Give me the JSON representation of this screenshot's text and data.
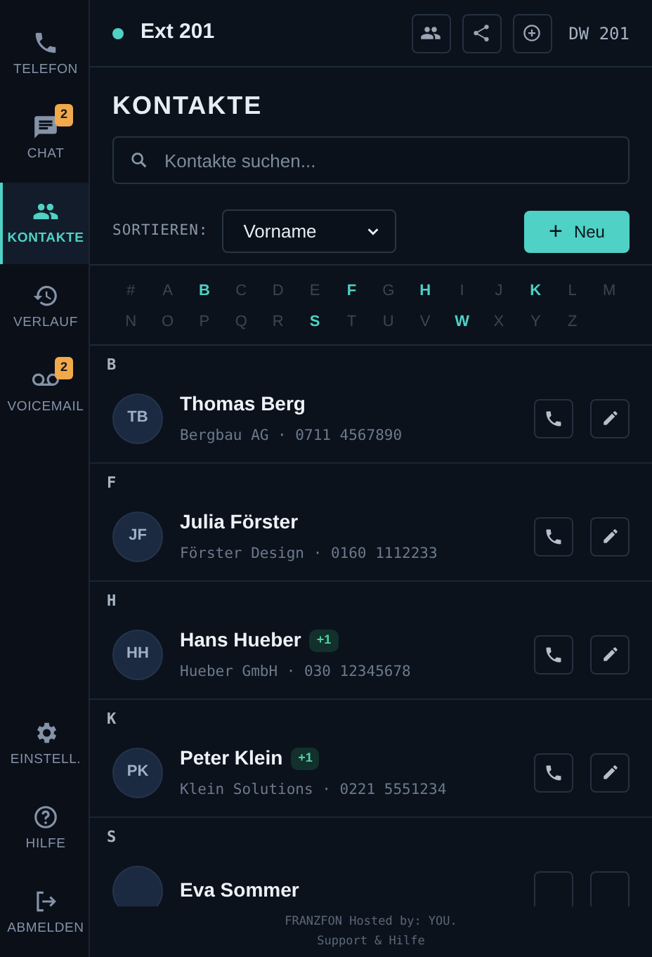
{
  "sidebar": {
    "items": [
      {
        "label": "TELEFON",
        "selected": false
      },
      {
        "label": "CHAT",
        "selected": false,
        "badge": "2"
      },
      {
        "label": "KONTAKTE",
        "selected": true
      },
      {
        "label": "VERLAUF",
        "selected": false
      },
      {
        "label": "VOICEMAIL",
        "selected": false,
        "badge": "2"
      }
    ],
    "bottom_items": [
      {
        "label": "EINSTELL."
      },
      {
        "label": "HILFE"
      },
      {
        "label": "ABMELDEN"
      }
    ]
  },
  "header": {
    "online": true,
    "extension": "Ext 201",
    "device": "DW 201"
  },
  "title": "KONTAKTE",
  "search": {
    "placeholder": "Kontakte suchen..."
  },
  "sort": {
    "label": "SORTIEREN:",
    "value": "Vorname"
  },
  "new_button": {
    "icon": "+",
    "label": "Neu"
  },
  "alphabet": [
    {
      "letter": "#",
      "active": false
    },
    {
      "letter": "A",
      "active": false
    },
    {
      "letter": "B",
      "active": true
    },
    {
      "letter": "C",
      "active": false
    },
    {
      "letter": "D",
      "active": false
    },
    {
      "letter": "E",
      "active": false
    },
    {
      "letter": "F",
      "active": true
    },
    {
      "letter": "G",
      "active": false
    },
    {
      "letter": "H",
      "active": true
    },
    {
      "letter": "I",
      "active": false
    },
    {
      "letter": "J",
      "active": false
    },
    {
      "letter": "K",
      "active": true
    },
    {
      "letter": "L",
      "active": false
    },
    {
      "letter": "M",
      "active": false
    },
    {
      "letter": "N",
      "active": false
    },
    {
      "letter": "O",
      "active": false
    },
    {
      "letter": "P",
      "active": false
    },
    {
      "letter": "Q",
      "active": false
    },
    {
      "letter": "R",
      "active": false
    },
    {
      "letter": "S",
      "active": true
    },
    {
      "letter": "T",
      "active": false
    },
    {
      "letter": "U",
      "active": false
    },
    {
      "letter": "V",
      "active": false
    },
    {
      "letter": "W",
      "active": true
    },
    {
      "letter": "X",
      "active": false
    },
    {
      "letter": "Y",
      "active": false
    },
    {
      "letter": "Z",
      "active": false
    }
  ],
  "groups": [
    {
      "letter": "B",
      "contacts": [
        {
          "initials": "TB",
          "name": "Thomas Berg",
          "details": "Bergbau AG · 0711 4567890"
        }
      ]
    },
    {
      "letter": "F",
      "contacts": [
        {
          "initials": "JF",
          "name": "Julia Förster",
          "details": "Förster Design · 0160 1112233"
        }
      ]
    },
    {
      "letter": "H",
      "contacts": [
        {
          "initials": "HH",
          "name": "Hans Hueber",
          "extra": "+1",
          "details": "Hueber GmbH · 030 12345678"
        }
      ]
    },
    {
      "letter": "K",
      "contacts": [
        {
          "initials": "PK",
          "name": "Peter Klein",
          "extra": "+1",
          "details": "Klein Solutions · 0221 5551234"
        }
      ]
    },
    {
      "letter": "S",
      "contacts": [
        {
          "name": "Eva Sommer"
        }
      ]
    }
  ],
  "footer": {
    "line": "FRANZFON Hosted by: YOU.",
    "link": "Support & Hilfe"
  }
}
